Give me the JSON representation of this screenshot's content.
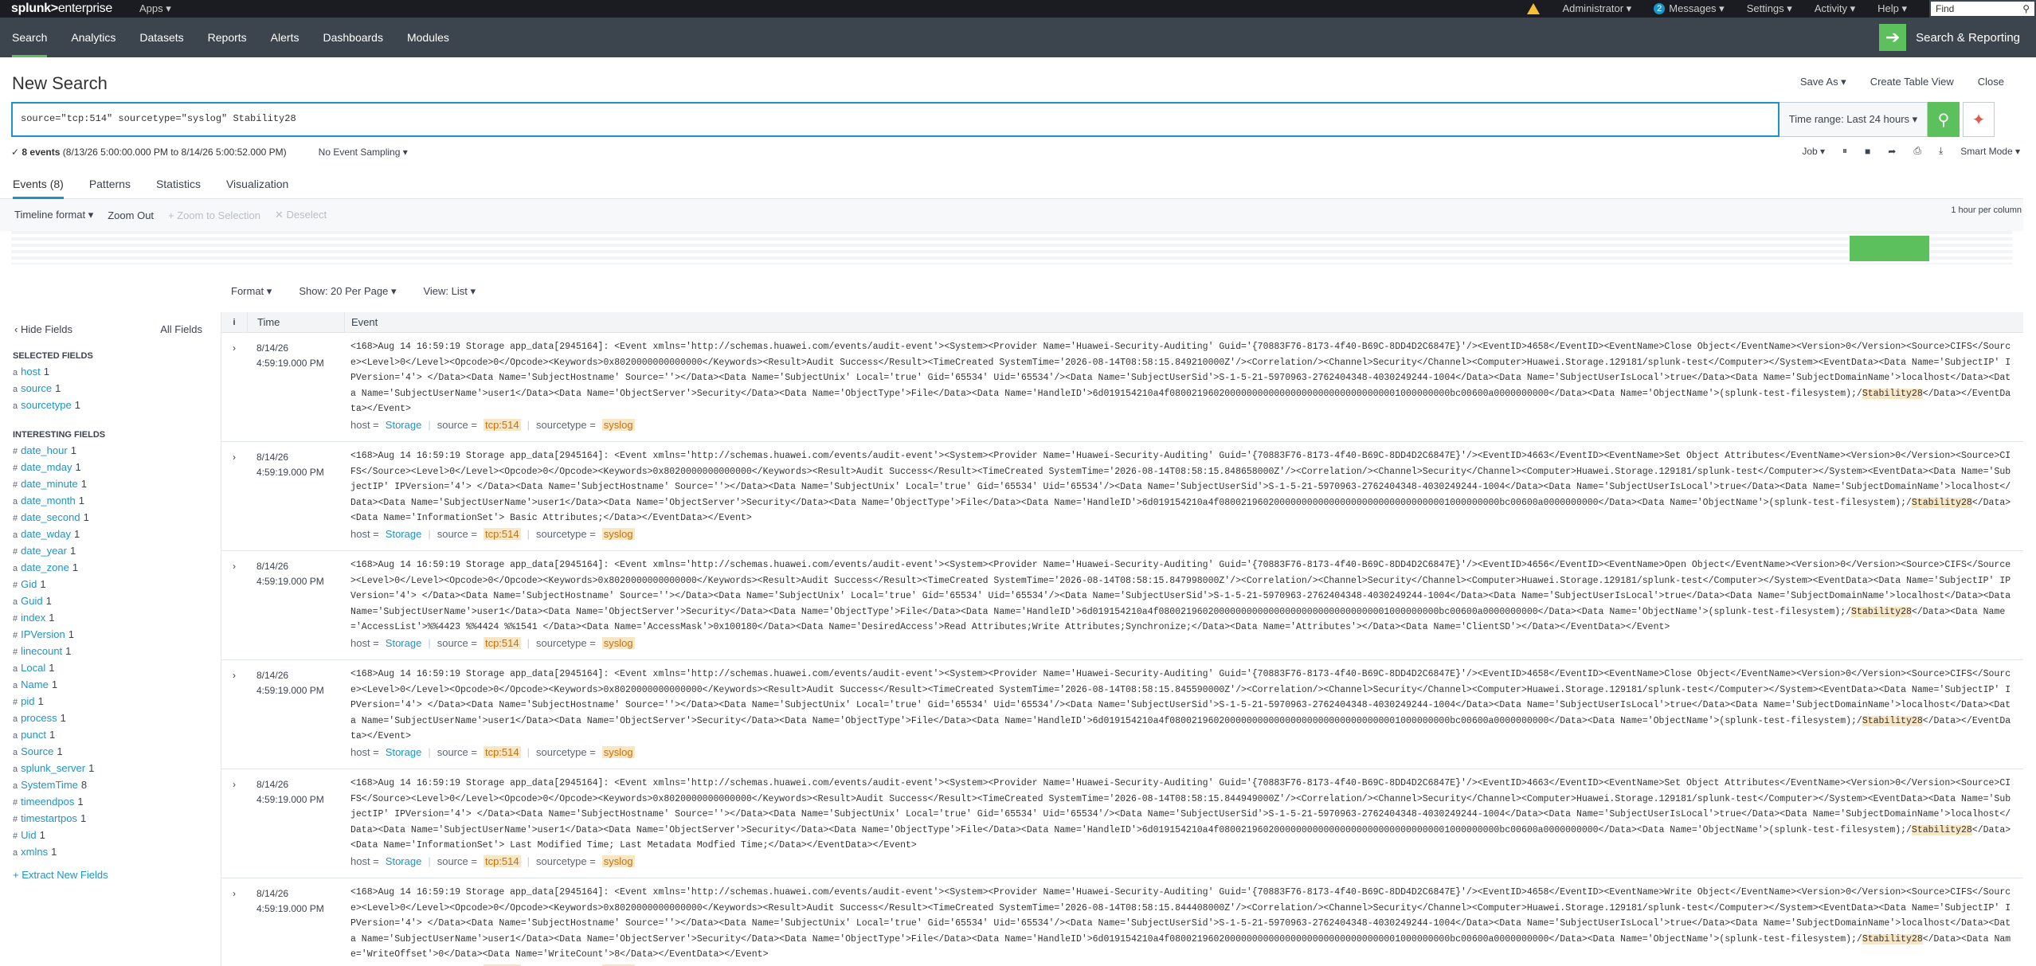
{
  "topbar": {
    "logo": "splunk>",
    "logo_ent": "enterprise",
    "apps": "Apps ▾",
    "admin": "Administrator ▾",
    "messages_count": "2",
    "messages": "Messages ▾",
    "settings": "Settings ▾",
    "activity": "Activity ▾",
    "help": "Help ▾",
    "find": "Find"
  },
  "nav": {
    "items": [
      "Search",
      "Analytics",
      "Datasets",
      "Reports",
      "Alerts",
      "Dashboards",
      "Modules"
    ],
    "app": "Search & Reporting"
  },
  "header": {
    "title": "New Search",
    "save_as": "Save As ▾",
    "create_table": "Create Table View",
    "close": "Close"
  },
  "search": {
    "query": "source=\"tcp:514\" sourcetype=\"syslog\" Stability28",
    "time_range": "Time range: Last 24 hours ▾"
  },
  "status": {
    "check": "✓",
    "events": "8 events",
    "range": "(8/13/26 5:00:00.000 PM to 8/14/26 5:00:52.000 PM)",
    "sampling": "No Event Sampling ▾",
    "job": "Job ▾",
    "mode": "Smart Mode ▾"
  },
  "tabs": [
    "Events (8)",
    "Patterns",
    "Statistics",
    "Visualization"
  ],
  "timeline": {
    "format": "Timeline format ▾",
    "zoom_out": "Zoom Out",
    "zoom_sel": "+ Zoom to Selection",
    "deselect": "✕ Deselect",
    "bucket": "1 hour per column"
  },
  "options": {
    "format": "Format ▾",
    "per_page": "Show: 20 Per Page ▾",
    "view": "View: List ▾"
  },
  "sidebar": {
    "hide": "‹ Hide Fields",
    "all": "All Fields",
    "selected_h": "SELECTED FIELDS",
    "interesting_h": "INTERESTING FIELDS",
    "extract": "+ Extract New Fields",
    "selected": [
      {
        "t": "a",
        "n": "host",
        "c": "1"
      },
      {
        "t": "a",
        "n": "source",
        "c": "1"
      },
      {
        "t": "a",
        "n": "sourcetype",
        "c": "1"
      }
    ],
    "interesting": [
      {
        "t": "#",
        "n": "date_hour",
        "c": "1"
      },
      {
        "t": "#",
        "n": "date_mday",
        "c": "1"
      },
      {
        "t": "#",
        "n": "date_minute",
        "c": "1"
      },
      {
        "t": "a",
        "n": "date_month",
        "c": "1"
      },
      {
        "t": "#",
        "n": "date_second",
        "c": "1"
      },
      {
        "t": "a",
        "n": "date_wday",
        "c": "1"
      },
      {
        "t": "#",
        "n": "date_year",
        "c": "1"
      },
      {
        "t": "a",
        "n": "date_zone",
        "c": "1"
      },
      {
        "t": "#",
        "n": "Gid",
        "c": "1"
      },
      {
        "t": "a",
        "n": "Guid",
        "c": "1"
      },
      {
        "t": "#",
        "n": "index",
        "c": "1"
      },
      {
        "t": "#",
        "n": "IPVersion",
        "c": "1"
      },
      {
        "t": "#",
        "n": "linecount",
        "c": "1"
      },
      {
        "t": "a",
        "n": "Local",
        "c": "1"
      },
      {
        "t": "a",
        "n": "Name",
        "c": "1"
      },
      {
        "t": "#",
        "n": "pid",
        "c": "1"
      },
      {
        "t": "a",
        "n": "process",
        "c": "1"
      },
      {
        "t": "a",
        "n": "punct",
        "c": "1"
      },
      {
        "t": "a",
        "n": "Source",
        "c": "1"
      },
      {
        "t": "a",
        "n": "splunk_server",
        "c": "1"
      },
      {
        "t": "a",
        "n": "SystemTime",
        "c": "8"
      },
      {
        "t": "#",
        "n": "timeendpos",
        "c": "1"
      },
      {
        "t": "#",
        "n": "timestartpos",
        "c": "1"
      },
      {
        "t": "#",
        "n": "Uid",
        "c": "1"
      },
      {
        "t": "a",
        "n": "xmlns",
        "c": "1"
      }
    ]
  },
  "results": {
    "col_i": "i",
    "col_time": "Time",
    "col_event": "Event",
    "rows": [
      {
        "date": "8/14/26",
        "time": "4:59:19.000 PM",
        "pre": "<168>Aug 14 16:59:19 Storage app_data[2945164]: <Event xmlns='http://schemas.huawei.com/events/audit-event'><System><Provider Name='Huawei-Security-Auditing' Guid='{70883F76-8173-4f40-B69C-8DD4D2C6847E}'/><EventID>4658</EventID><EventName>Close Object</EventName><Version>0</Version><Source>CIFS</Source><Level>0</Level><Opcode>0</Opcode><Keywords>0x8020000000000000</Keywords><Result>Audit Success</Result><TimeCreated SystemTime='2026-08-14T08:58:15.849210000Z'/><Correlation/><Channel>Security</Channel><Computer>Huawei.Storage.129181/splunk-test</Computer></System><EventData><Data Name='SubjectIP' IPVersion='4'>          </Data><Data Name='SubjectHostname' Source=''></Data><Data Name='SubjectUnix' Local='true' Gid='65534' Uid='65534'/><Data Name='SubjectUserSid'>S-1-5-21-5970963-2762404348-4030249244-1004</Data><Data Name='SubjectUserIsLocal'>true</Data><Data Name='SubjectDomainName'>localhost</Data><Data Name='SubjectUserName'>user1</Data><Data Name='ObjectServer'>Security</Data><Data Name='ObjectType'>File</Data><Data Name='HandleID'>6d019154210a4f080021960200000000000000000000000000000001000000000bc00600a0000000000</Data><Data Name='ObjectName'>(splunk-test-filesystem);/",
        "kw": "Stability28",
        "post": "</Data></EventData></Event>"
      },
      {
        "date": "8/14/26",
        "time": "4:59:19.000 PM",
        "pre": "<168>Aug 14 16:59:19 Storage app_data[2945164]: <Event xmlns='http://schemas.huawei.com/events/audit-event'><System><Provider Name='Huawei-Security-Auditing' Guid='{70883F76-8173-4f40-B69C-8DD4D2C6847E}'/><EventID>4663</EventID><EventName>Set Object Attributes</EventName><Version>0</Version><Source>CIFS</Source><Level>0</Level><Opcode>0</Opcode><Keywords>0x8020000000000000</Keywords><Result>Audit Success</Result><TimeCreated SystemTime='2026-08-14T08:58:15.848658000Z'/><Correlation/><Channel>Security</Channel><Computer>Huawei.Storage.129181/splunk-test</Computer></System><EventData><Data Name='SubjectIP' IPVersion='4'>          </Data><Data Name='SubjectHostname' Source=''></Data><Data Name='SubjectUnix' Local='true' Gid='65534' Uid='65534'/><Data Name='SubjectUserSid'>S-1-5-21-5970963-2762404348-4030249244-1004</Data><Data Name='SubjectUserIsLocal'>true</Data><Data Name='SubjectDomainName'>localhost</Data><Data Name='SubjectUserName'>user1</Data><Data Name='ObjectServer'>Security</Data><Data Name='ObjectType'>File</Data><Data Name='HandleID'>6d019154210a4f080021960200000000000000000000000000000001000000000bc00600a0000000000</Data><Data Name='ObjectName'>(splunk-test-filesystem);/",
        "kw": "Stability28",
        "post": "</Data><Data Name='InformationSet'> Basic Attributes;</Data></EventData></Event>"
      },
      {
        "date": "8/14/26",
        "time": "4:59:19.000 PM",
        "pre": "<168>Aug 14 16:59:19 Storage app_data[2945164]: <Event xmlns='http://schemas.huawei.com/events/audit-event'><System><Provider Name='Huawei-Security-Auditing' Guid='{70883F76-8173-4f40-B69C-8DD4D2C6847E}'/><EventID>4656</EventID><EventName>Open Object</EventName><Version>0</Version><Source>CIFS</Source><Level>0</Level><Opcode>0</Opcode><Keywords>0x8020000000000000</Keywords><Result>Audit Success</Result><TimeCreated SystemTime='2026-08-14T08:58:15.847998000Z'/><Correlation/><Channel>Security</Channel><Computer>Huawei.Storage.129181/splunk-test</Computer></System><EventData><Data Name='SubjectIP' IPVersion='4'>          </Data><Data Name='SubjectHostname' Source=''></Data><Data Name='SubjectUnix' Local='true' Gid='65534' Uid='65534'/><Data Name='SubjectUserSid'>S-1-5-21-5970963-2762404348-4030249244-1004</Data><Data Name='SubjectUserIsLocal'>true</Data><Data Name='SubjectDomainName'>localhost</Data><Data Name='SubjectUserName'>user1</Data><Data Name='ObjectServer'>Security</Data><Data Name='ObjectType'>File</Data><Data Name='HandleID'>6d019154210a4f080021960200000000000000000000000000000001000000000bc00600a0000000000</Data><Data Name='ObjectName'>(splunk-test-filesystem);/",
        "kw": "Stability28",
        "post": "</Data><Data Name='AccessList'>%%4423 %%4424 %%1541 </Data><Data Name='AccessMask'>0x100180</Data><Data Name='DesiredAccess'>Read Attributes;Write Attributes;Synchronize;</Data><Data Name='Attributes'></Data><Data Name='ClientSD'></Data></EventData></Event>"
      },
      {
        "date": "8/14/26",
        "time": "4:59:19.000 PM",
        "pre": "<168>Aug 14 16:59:19 Storage app_data[2945164]: <Event xmlns='http://schemas.huawei.com/events/audit-event'><System><Provider Name='Huawei-Security-Auditing' Guid='{70883F76-8173-4f40-B69C-8DD4D2C6847E}'/><EventID>4658</EventID><EventName>Close Object</EventName><Version>0</Version><Source>CIFS</Source><Level>0</Level><Opcode>0</Opcode><Keywords>0x8020000000000000</Keywords><Result>Audit Success</Result><TimeCreated SystemTime='2026-08-14T08:58:15.845590000Z'/><Correlation/><Channel>Security</Channel><Computer>Huawei.Storage.129181/splunk-test</Computer></System><EventData><Data Name='SubjectIP' IPVersion='4'>          </Data><Data Name='SubjectHostname' Source=''></Data><Data Name='SubjectUnix' Local='true' Gid='65534' Uid='65534'/><Data Name='SubjectUserSid'>S-1-5-21-5970963-2762404348-4030249244-1004</Data><Data Name='SubjectUserIsLocal'>true</Data><Data Name='SubjectDomainName'>localhost</Data><Data Name='SubjectUserName'>user1</Data><Data Name='ObjectServer'>Security</Data><Data Name='ObjectType'>File</Data><Data Name='HandleID'>6d019154210a4f080021960200000000000000000000000000000001000000000bc00600a0000000000</Data><Data Name='ObjectName'>(splunk-test-filesystem);/",
        "kw": "Stability28",
        "post": "</Data></EventData></Event>"
      },
      {
        "date": "8/14/26",
        "time": "4:59:19.000 PM",
        "pre": "<168>Aug 14 16:59:19 Storage app_data[2945164]: <Event xmlns='http://schemas.huawei.com/events/audit-event'><System><Provider Name='Huawei-Security-Auditing' Guid='{70883F76-8173-4f40-B69C-8DD4D2C6847E}'/><EventID>4663</EventID><EventName>Set Object Attributes</EventName><Version>0</Version><Source>CIFS</Source><Level>0</Level><Opcode>0</Opcode><Keywords>0x8020000000000000</Keywords><Result>Audit Success</Result><TimeCreated SystemTime='2026-08-14T08:58:15.844949000Z'/><Correlation/><Channel>Security</Channel><Computer>Huawei.Storage.129181/splunk-test</Computer></System><EventData><Data Name='SubjectIP' IPVersion='4'>          </Data><Data Name='SubjectHostname' Source=''></Data><Data Name='SubjectUnix' Local='true' Gid='65534' Uid='65534'/><Data Name='SubjectUserSid'>S-1-5-21-5970963-2762404348-4030249244-1004</Data><Data Name='SubjectUserIsLocal'>true</Data><Data Name='SubjectDomainName'>localhost</Data><Data Name='SubjectUserName'>user1</Data><Data Name='ObjectServer'>Security</Data><Data Name='ObjectType'>File</Data><Data Name='HandleID'>6d019154210a4f080021960200000000000000000000000000000001000000000bc00600a0000000000</Data><Data Name='ObjectName'>(splunk-test-filesystem);/",
        "kw": "Stability28",
        "post": "</Data><Data Name='InformationSet'> Last Modified Time; Last Metadata Modfied Time;</Data></EventData></Event>"
      },
      {
        "date": "8/14/26",
        "time": "4:59:19.000 PM",
        "pre": "<168>Aug 14 16:59:19 Storage app_data[2945164]: <Event xmlns='http://schemas.huawei.com/events/audit-event'><System><Provider Name='Huawei-Security-Auditing' Guid='{70883F76-8173-4f40-B69C-8DD4D2C6847E}'/><EventID>4658</EventID><EventName>Write Object</EventName><Version>0</Version><Source>CIFS</Source><Level>0</Level><Opcode>0</Opcode><Keywords>0x8020000000000000</Keywords><Result>Audit Success</Result><TimeCreated SystemTime='2026-08-14T08:58:15.844408000Z'/><Correlation/><Channel>Security</Channel><Computer>Huawei.Storage.129181/splunk-test</Computer></System><EventData><Data Name='SubjectIP' IPVersion='4'>          </Data><Data Name='SubjectHostname' Source=''></Data><Data Name='SubjectUnix' Local='true' Gid='65534' Uid='65534'/><Data Name='SubjectUserSid'>S-1-5-21-5970963-2762404348-4030249244-1004</Data><Data Name='SubjectUserIsLocal'>true</Data><Data Name='SubjectDomainName'>localhost</Data><Data Name='SubjectUserName'>user1</Data><Data Name='ObjectServer'>Security</Data><Data Name='ObjectType'>File</Data><Data Name='HandleID'>6d019154210a4f080021960200000000000000000000000000000001000000000bc00600a0000000000</Data><Data Name='ObjectName'>(splunk-test-filesystem);/",
        "kw": "Stability28",
        "post": "</Data><Data Name='WriteOffset'>0</Data><Data Name='WriteCount'>8</Data></EventData></Event>"
      }
    ],
    "meta": {
      "host_k": "host =",
      "host_v": "Storage",
      "source_k": "source =",
      "source_v": "tcp:514",
      "st_k": "sourcetype =",
      "st_v": "syslog"
    }
  },
  "colors": {
    "accent": "#5cc05c",
    "link": "#1e93c6",
    "nav": "#3c444d",
    "topbar": "#1a1c21"
  }
}
